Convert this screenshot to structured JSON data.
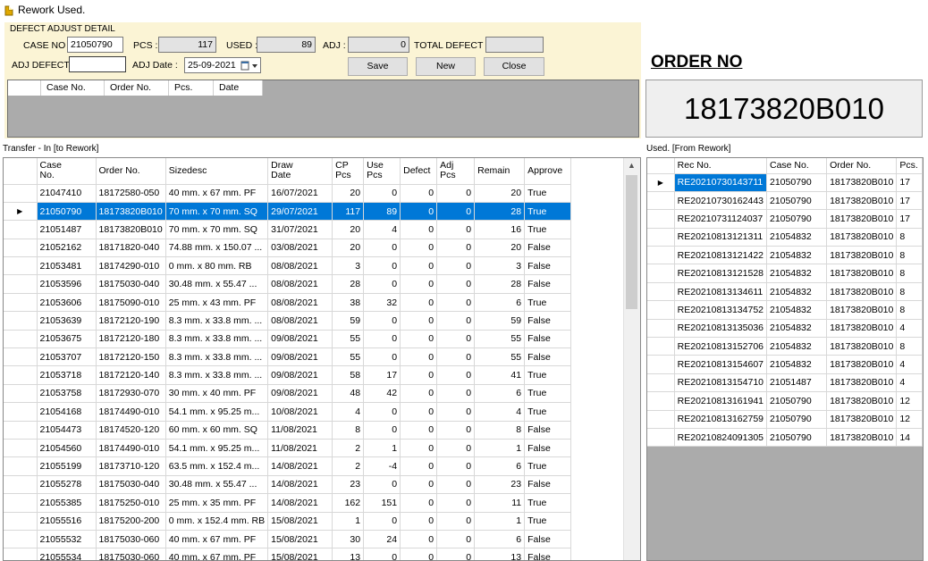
{
  "window": {
    "title": "Rework Used."
  },
  "adjust": {
    "caption": "DEFECT ADJUST DETAIL",
    "case_no_label": "CASE NO :",
    "case_no_value": "21050790",
    "pcs_label": "PCS :",
    "pcs_value": "117",
    "used_label": "USED :",
    "used_value": "89",
    "adj_label": "ADJ :",
    "adj_value": "0",
    "total_defect_label": "TOTAL DEFECT :",
    "total_defect_value": "",
    "adj_defect_label": "ADJ DEFECT :",
    "adj_defect_value": "",
    "adj_date_label": "ADJ Date :",
    "adj_date_value": "25-09-2021",
    "save_label": "Save",
    "new_label": "New",
    "close_label": "Close",
    "mini_columns": [
      "Case No.",
      "Order No.",
      "Pcs.",
      "Date"
    ]
  },
  "order": {
    "label": "ORDER NO",
    "value": "18173820B010"
  },
  "transfer": {
    "title": "Transfer - In [to Rework]",
    "columns": [
      "Case\nNo.",
      "Order No.",
      "Sizedesc",
      "Draw\nDate",
      "CP\nPcs",
      "Use\nPcs",
      "Defect",
      "Adj\nPcs",
      "Remain",
      "Approve"
    ],
    "selected_index": 1,
    "rows": [
      [
        "21047410",
        "18172580-050",
        "40 mm. x 67 mm.  PF",
        "16/07/2021",
        "20",
        "0",
        "0",
        "0",
        "20",
        "True"
      ],
      [
        "21050790",
        "18173820B010",
        "70 mm. x 70 mm.  SQ",
        "29/07/2021",
        "117",
        "89",
        "0",
        "0",
        "28",
        "True"
      ],
      [
        "21051487",
        "18173820B010",
        "70 mm. x 70 mm.  SQ",
        "31/07/2021",
        "20",
        "4",
        "0",
        "0",
        "16",
        "True"
      ],
      [
        "21052162",
        "18171820-040",
        "74.88 mm. x 150.07 ...",
        "03/08/2021",
        "20",
        "0",
        "0",
        "0",
        "20",
        "False"
      ],
      [
        "21053481",
        "18174290-010",
        "0 mm. x 80 mm.  RB",
        "08/08/2021",
        "3",
        "0",
        "0",
        "0",
        "3",
        "False"
      ],
      [
        "21053596",
        "18175030-040",
        "30.48 mm. x 55.47 ...",
        "08/08/2021",
        "28",
        "0",
        "0",
        "0",
        "28",
        "False"
      ],
      [
        "21053606",
        "18175090-010",
        "25 mm. x 43 mm.  PF",
        "08/08/2021",
        "38",
        "32",
        "0",
        "0",
        "6",
        "True"
      ],
      [
        "21053639",
        "18172120-190",
        "8.3 mm. x 33.8 mm. ...",
        "08/08/2021",
        "59",
        "0",
        "0",
        "0",
        "59",
        "False"
      ],
      [
        "21053675",
        "18172120-180",
        "8.3 mm. x 33.8 mm. ...",
        "09/08/2021",
        "55",
        "0",
        "0",
        "0",
        "55",
        "False"
      ],
      [
        "21053707",
        "18172120-150",
        "8.3 mm. x 33.8 mm. ...",
        "09/08/2021",
        "55",
        "0",
        "0",
        "0",
        "55",
        "False"
      ],
      [
        "21053718",
        "18172120-140",
        "8.3 mm. x 33.8 mm. ...",
        "09/08/2021",
        "58",
        "17",
        "0",
        "0",
        "41",
        "True"
      ],
      [
        "21053758",
        "18172930-070",
        "30 mm. x 40 mm.  PF",
        "09/08/2021",
        "48",
        "42",
        "0",
        "0",
        "6",
        "True"
      ],
      [
        "21054168",
        "18174490-010",
        "54.1 mm. x 95.25 m...",
        "10/08/2021",
        "4",
        "0",
        "0",
        "0",
        "4",
        "True"
      ],
      [
        "21054473",
        "18174520-120",
        "60 mm. x 60 mm.  SQ",
        "11/08/2021",
        "8",
        "0",
        "0",
        "0",
        "8",
        "False"
      ],
      [
        "21054560",
        "18174490-010",
        "54.1 mm. x 95.25 m...",
        "11/08/2021",
        "2",
        "1",
        "0",
        "0",
        "1",
        "False"
      ],
      [
        "21055199",
        "18173710-120",
        "63.5 mm. x 152.4 m...",
        "14/08/2021",
        "2",
        "-4",
        "0",
        "0",
        "6",
        "True"
      ],
      [
        "21055278",
        "18175030-040",
        "30.48 mm. x 55.47 ...",
        "14/08/2021",
        "23",
        "0",
        "0",
        "0",
        "23",
        "False"
      ],
      [
        "21055385",
        "18175250-010",
        "25 mm. x 35 mm.  PF",
        "14/08/2021",
        "162",
        "151",
        "0",
        "0",
        "11",
        "True"
      ],
      [
        "21055516",
        "18175200-200",
        "0 mm. x 152.4 mm.  RB",
        "15/08/2021",
        "1",
        "0",
        "0",
        "0",
        "1",
        "True"
      ],
      [
        "21055532",
        "18175030-060",
        "40 mm. x 67 mm.  PF",
        "15/08/2021",
        "30",
        "24",
        "0",
        "0",
        "6",
        "False"
      ],
      [
        "21055534",
        "18175030-060",
        "40 mm. x 67 mm.  PF",
        "15/08/2021",
        "13",
        "0",
        "0",
        "0",
        "13",
        "False"
      ]
    ]
  },
  "used": {
    "title": "Used. [From Rework]",
    "columns": [
      "Rec No.",
      "Case No.",
      "Order No.",
      "Pcs."
    ],
    "selected_index": 0,
    "rows": [
      [
        "RE20210730143711",
        "21050790",
        "18173820B010",
        "17"
      ],
      [
        "RE20210730162443",
        "21050790",
        "18173820B010",
        "17"
      ],
      [
        "RE20210731124037",
        "21050790",
        "18173820B010",
        "17"
      ],
      [
        "RE20210813121311",
        "21054832",
        "18173820B010",
        "8"
      ],
      [
        "RE20210813121422",
        "21054832",
        "18173820B010",
        "8"
      ],
      [
        "RE20210813121528",
        "21054832",
        "18173820B010",
        "8"
      ],
      [
        "RE20210813134611",
        "21054832",
        "18173820B010",
        "8"
      ],
      [
        "RE20210813134752",
        "21054832",
        "18173820B010",
        "8"
      ],
      [
        "RE20210813135036",
        "21054832",
        "18173820B010",
        "4"
      ],
      [
        "RE20210813152706",
        "21054832",
        "18173820B010",
        "8"
      ],
      [
        "RE20210813154607",
        "21054832",
        "18173820B010",
        "4"
      ],
      [
        "RE20210813154710",
        "21051487",
        "18173820B010",
        "4"
      ],
      [
        "RE20210813161941",
        "21050790",
        "18173820B010",
        "12"
      ],
      [
        "RE20210813162759",
        "21050790",
        "18173820B010",
        "12"
      ],
      [
        "RE20210824091305",
        "21050790",
        "18173820B010",
        "14"
      ]
    ]
  }
}
